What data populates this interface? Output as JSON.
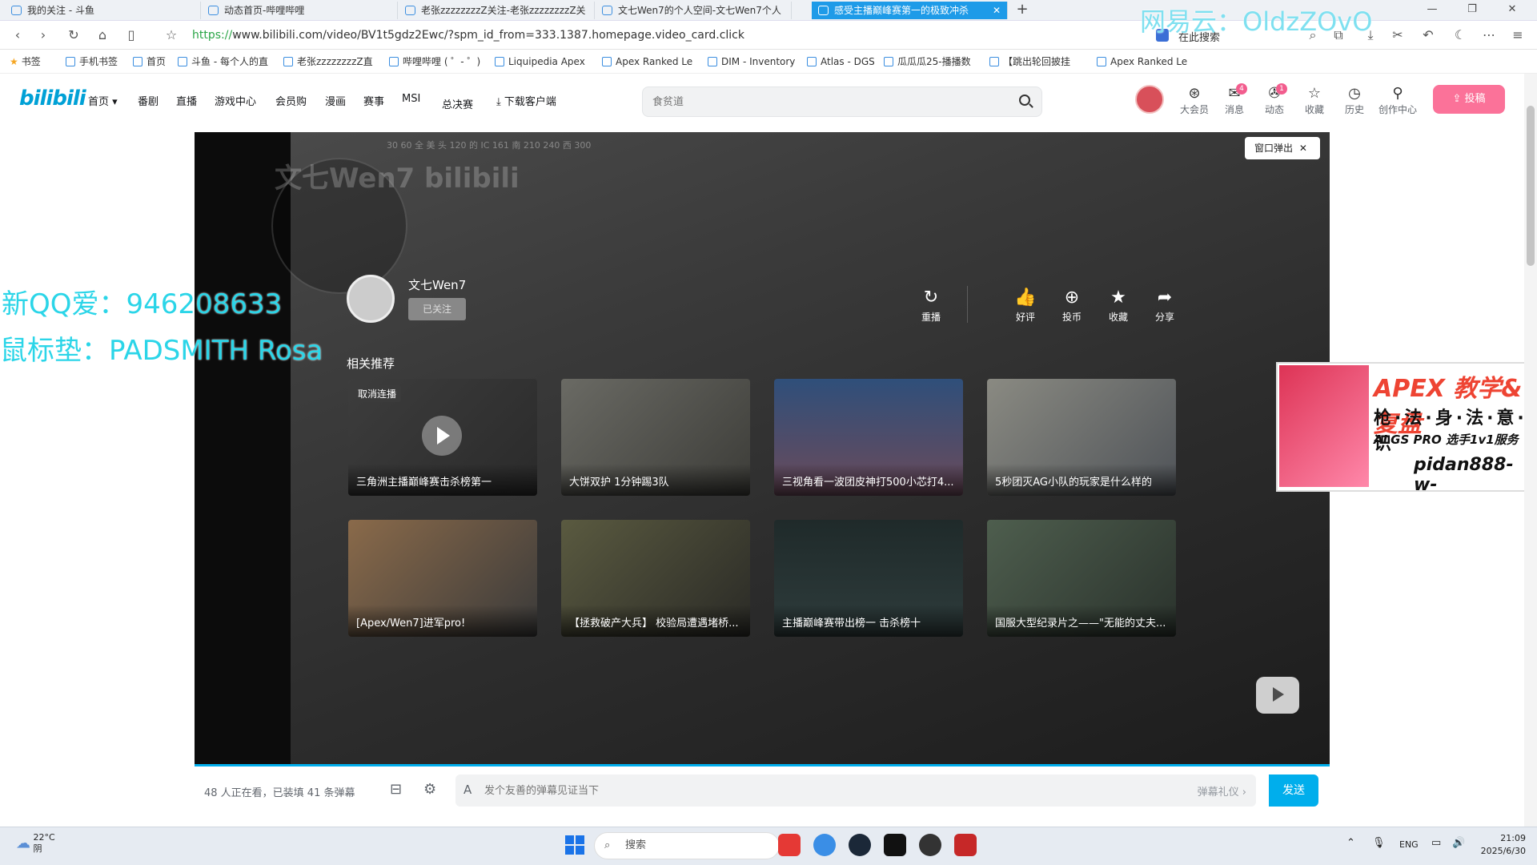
{
  "browser": {
    "tabs": [
      {
        "label": "我的关注 - 斗鱼",
        "active": false
      },
      {
        "label": "动态首页-哔哩哔哩",
        "active": false
      },
      {
        "label": "老张zzzzzzzzZ关注-老张zzzzzzzzZ关",
        "active": false
      },
      {
        "label": "文七Wen7的个人空间-文七Wen7个人",
        "active": false
      },
      {
        "label": "感受主播巅峰赛第一的极致冲杀",
        "active": true
      }
    ],
    "url_protocol": "https://",
    "url_rest": "www.bilibili.com/video/BV1t5gdz2Ewc/?spm_id_from=333.1387.homepage.video_card.click",
    "search_label": "在此搜索",
    "bookmarks": [
      "书签",
      "手机书签",
      "首页",
      "斗鱼 - 每个人的直",
      "老张zzzzzzzzZ直",
      "哔哩哔哩 ( ゜- ゜)",
      "Liquipedia Apex",
      "Apex Ranked Le",
      "DIM - Inventory",
      "Atlas - DGS",
      "瓜瓜瓜25-播播数",
      "【跳出轮回披挂",
      "Apex Ranked Le"
    ]
  },
  "bili": {
    "logo": "bilibili",
    "nav": [
      "首页",
      "番剧",
      "直播",
      "游戏中心",
      "会员购",
      "漫画",
      "赛事",
      "MSI",
      "总决赛",
      "下载客户端"
    ],
    "search_placeholder": "食贫道",
    "icons": [
      {
        "label": "大会员",
        "glyph": "⊛",
        "badge": ""
      },
      {
        "label": "消息",
        "glyph": "✉",
        "badge": "4"
      },
      {
        "label": "动态",
        "glyph": "✇",
        "badge": "1"
      },
      {
        "label": "收藏",
        "glyph": "☆",
        "badge": ""
      },
      {
        "label": "历史",
        "glyph": "◷",
        "badge": ""
      },
      {
        "label": "创作中心",
        "glyph": "⚲",
        "badge": ""
      }
    ],
    "upload_label": "投稿"
  },
  "player": {
    "watermark": "文七Wen7 bilibili",
    "hud_compass": "30   60   全  美  头  120  的  IC  161  南  210  240  西  300",
    "popout_label": "窗口弹出",
    "up_name": "文七Wen7",
    "follow_label": "已关注",
    "actions": [
      {
        "label": "重播",
        "glyph": "↻"
      },
      {
        "label": "好评",
        "glyph": "👍"
      },
      {
        "label": "投币",
        "glyph": "⊕"
      },
      {
        "label": "收藏",
        "glyph": "★"
      },
      {
        "label": "分享",
        "glyph": "➦"
      }
    ],
    "related_title": "相关推荐",
    "cards": [
      {
        "title": "三角洲主播巅峰赛击杀榜第一",
        "badge": "取消连播"
      },
      {
        "title": "大饼双护 1分钟踢3队",
        "badge": ""
      },
      {
        "title": "三视角看一波团皮神打500小芯打4...",
        "badge": ""
      },
      {
        "title": "5秒团灭AG小队的玩家是什么样的",
        "badge": ""
      },
      {
        "title": "[Apex/Wen7]进军pro!",
        "badge": ""
      },
      {
        "title": "【拯救破产大兵】 校验局遭遇堵桥...",
        "badge": ""
      },
      {
        "title": "主播巅峰赛带出榜一 击杀榜十",
        "badge": ""
      },
      {
        "title": "国服大型纪录片之——\"无能的丈夫...",
        "badge": ""
      }
    ]
  },
  "overlay": {
    "qq": "新QQ爱：946208633",
    "mousepad": "鼠标垫：PADSMITH Rosa",
    "netease": "网易云：OldzZOvO"
  },
  "ad": {
    "line1": "APEX 教学&复盘",
    "line2": "枪·法·身·法·意·识",
    "line3": "ALGS PRO 选手1v1服务",
    "line4": "pidan888-w-"
  },
  "danmaku": {
    "viewers": "48 人正在看，已装填 41 条弹幕",
    "placeholder": "发个友善的弹幕见证当下",
    "etiquette": "弹幕礼仪 ›",
    "send_label": "发送"
  },
  "taskbar": {
    "temp": "22°C",
    "weather": "阴",
    "search_label": "搜索",
    "lang": "ENG",
    "time": "21:09",
    "date": "2025/6/30"
  },
  "colors": {
    "bili_blue": "#00a1d6",
    "bili_pink": "#fb7299",
    "send_blue": "#00aeec",
    "overlay_cyan": "#2bd5e8"
  }
}
